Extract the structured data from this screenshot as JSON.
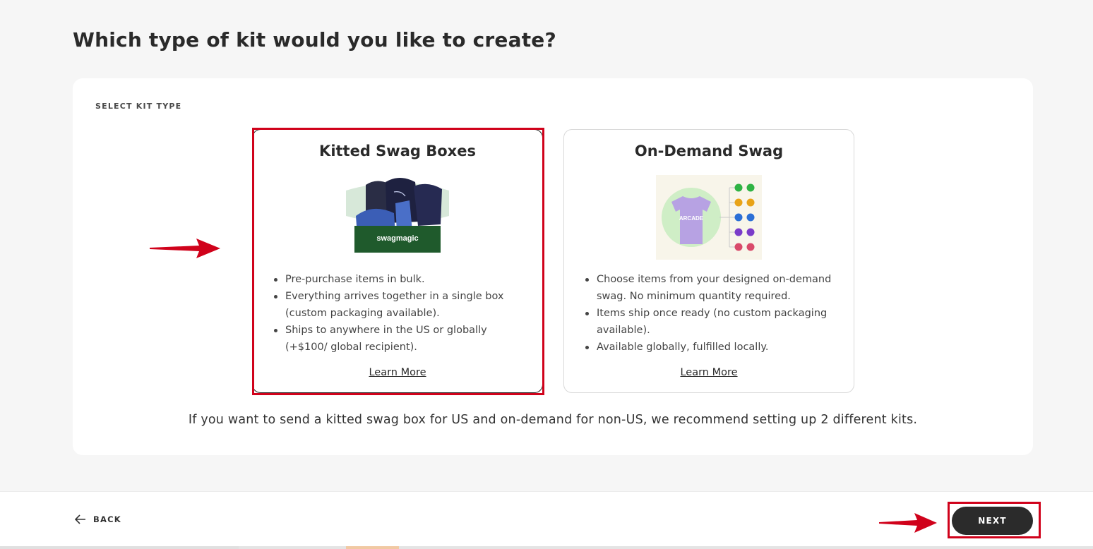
{
  "page": {
    "title": "Which type of kit would you like to create?"
  },
  "section": {
    "label": "SELECT KIT TYPE"
  },
  "cards": [
    {
      "title": "Kitted Swag Boxes",
      "image_text": "swagmagic",
      "bullets": [
        "Pre-purchase items in bulk.",
        "Everything arrives together in a single box (custom packaging available).",
        "Ships to anywhere in the US or globally (+$100/ global recipient)."
      ],
      "learn_more": "Learn More",
      "selected": true
    },
    {
      "title": "On-Demand Swag",
      "image_text": "ARCADE",
      "bullets": [
        "Choose items from your designed on-demand swag. No minimum quantity required.",
        "Items ship once ready (no custom packaging available).",
        "Available globally, fulfilled locally."
      ],
      "learn_more": "Learn More",
      "selected": false
    }
  ],
  "note": "If you want to send a kitted swag box for US and on-demand for non-US, we recommend setting up 2 different kits.",
  "footer": {
    "back_label": "BACK",
    "next_label": "NEXT"
  },
  "colors": {
    "annotation_red": "#d0021b",
    "primary_button": "#2b2b2b",
    "page_bg": "#f6f6f6"
  },
  "icons": {
    "back": "arrow-left-icon"
  }
}
